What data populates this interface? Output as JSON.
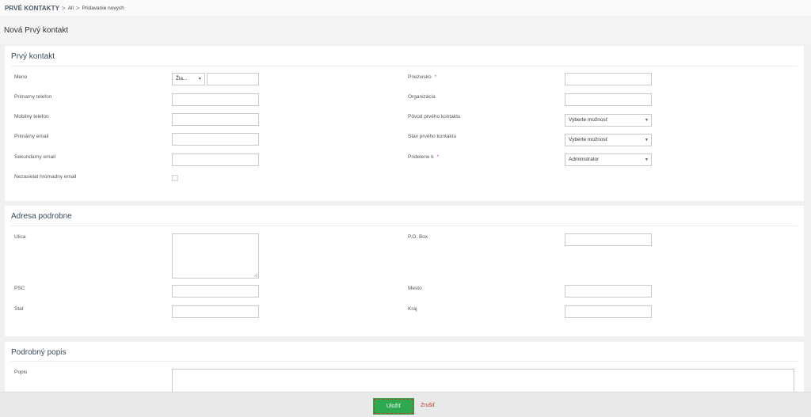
{
  "breadcrumb": {
    "module": "PRVÉ KONTAKTY",
    "separator": ">",
    "filter": "All",
    "action": "Pridavanie novych"
  },
  "page": {
    "title": "Nová Prvý kontakt"
  },
  "section_contact": {
    "title": "Prvý kontakt",
    "meno_label": "Meno",
    "salutation_value": "Žia...",
    "priezvisko_label": "Priezvisko",
    "required_mark": "*",
    "primarny_telefon_label": "Primarny telefon",
    "organizacia_label": "Organizácia",
    "mobilny_telefon_label": "Mobilny telefon",
    "povod_label": "Pôvod prvého kontaktu",
    "povod_value": "Vyberte možnosť",
    "primarny_email_label": "Primárny email",
    "stav_label": "Stav prvého kontaktu",
    "stav_value": "Vyberte možnosť",
    "sekundarny_email_label": "Sekundarny email",
    "pridelene_label": "Pridelene k",
    "pridelene_value": "Administrator",
    "nezasielat_label": "Nezasielat hromadny email",
    "nezasielat_checked": false
  },
  "section_address": {
    "title": "Adresa podrobne",
    "ulica_label": "Ulica",
    "pobox_label": "P.O. Box",
    "psc_label": "PSC",
    "mesto_label": "Mesto",
    "stat_label": "Stat",
    "kraj_label": "Kraj"
  },
  "section_description": {
    "title": "Podrobný popis",
    "popis_label": "Popis"
  },
  "footer": {
    "save_label": "Uložiť",
    "cancel_label": "Zrušiť"
  },
  "colors": {
    "save_bg": "#2ea94f",
    "cancel_text": "#c0392b",
    "required": "#d9534f"
  }
}
